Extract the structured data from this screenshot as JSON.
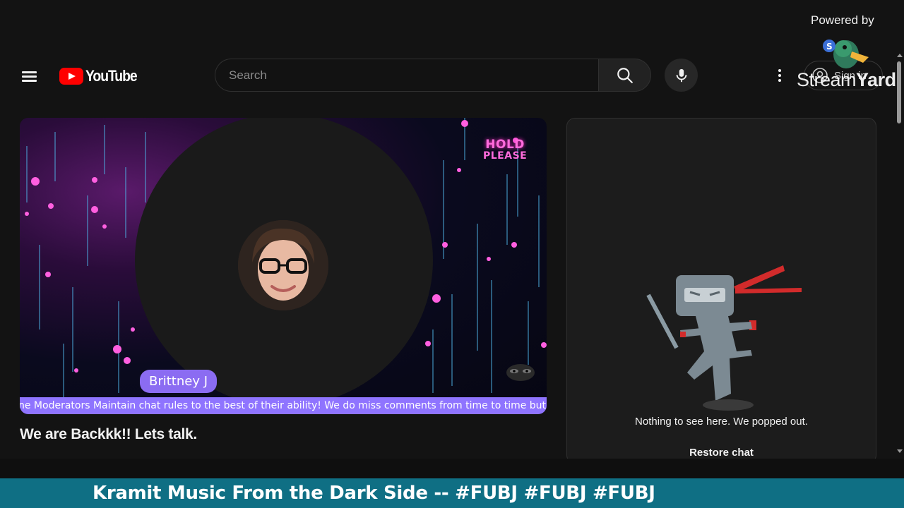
{
  "header": {
    "logo_text": "YouTube",
    "search_placeholder": "Search",
    "signin_label": "Sign in"
  },
  "overlay": {
    "powered_by": "Powered by",
    "brand_light": "Stream",
    "brand_bold": "Yard"
  },
  "video": {
    "hold_line1": "HOLD",
    "hold_line2": "PLEASE",
    "presenter_name": "Brittney J",
    "ticker_text": "ne Moderators Maintain chat rules to the best of their ability! We do miss comments from time to time but w",
    "title": "We are Backkk!! Lets talk."
  },
  "chat": {
    "message": "Nothing to see here. We popped out.",
    "restore_label": "Restore chat"
  },
  "banner": {
    "text": "Kramit Music From the Dark Side -- #FUBJ #FUBJ #FUBJ"
  },
  "colors": {
    "youtube_red": "#ff0000",
    "nametag": "#8b6cf2",
    "ticker": "#8f74ff",
    "banner": "#0f6f84"
  }
}
